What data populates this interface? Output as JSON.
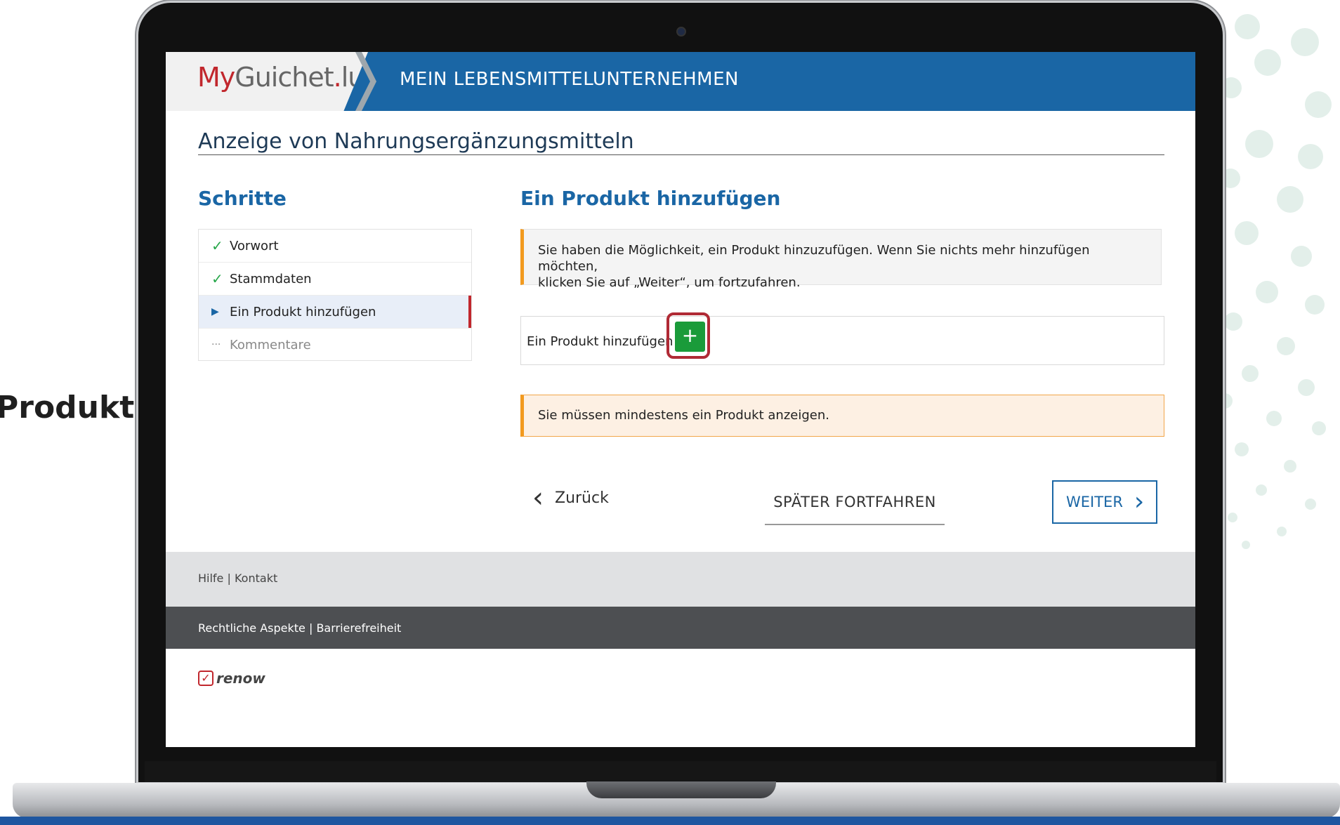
{
  "side_caption": "Produkt",
  "brand": {
    "part1": "My",
    "part2": "Guichet",
    "part3": ".",
    "part4": "lu"
  },
  "header_title": "MEIN LEBENSMITTELUNTERNEHMEN",
  "page_title": "Anzeige von Nahrungsergänzungsmitteln",
  "steps": {
    "heading": "Schritte",
    "items": [
      {
        "label": "Vorwort",
        "state": "done",
        "icon": "check-icon"
      },
      {
        "label": "Stammdaten",
        "state": "done",
        "icon": "check-icon"
      },
      {
        "label": "Ein Produkt hinzufügen",
        "state": "active",
        "icon": "triangle-right-icon"
      },
      {
        "label": "Kommentare",
        "state": "pending",
        "icon": "ellipsis-icon"
      }
    ]
  },
  "main": {
    "heading": "Ein Produkt hinzufügen",
    "info_line1": "Sie haben die Möglichkeit, ein Produkt hinzuzufügen. Wenn Sie nichts mehr hinzufügen möchten,",
    "info_line2": "klicken Sie auf „Weiter“, um fortzufahren.",
    "add_label": "Ein Produkt hinzufügen",
    "add_button": "+",
    "warning": "Sie müssen mindestens ein Produkt anzeigen."
  },
  "nav": {
    "back": "Zurück",
    "later": "SPÄTER FORTFAHREN",
    "next": "WEITER"
  },
  "footer": {
    "help": "Hilfe",
    "separator": "|",
    "contact": "Kontakt",
    "legal": "Rechtliche Aspekte",
    "accessibility": "Barrierefreiheit",
    "logo_text": "renow"
  },
  "colors": {
    "brand_blue": "#1a66a5",
    "brand_red": "#c1272d",
    "add_green": "#1a9b3a",
    "warning_orange": "#f29a1f"
  }
}
